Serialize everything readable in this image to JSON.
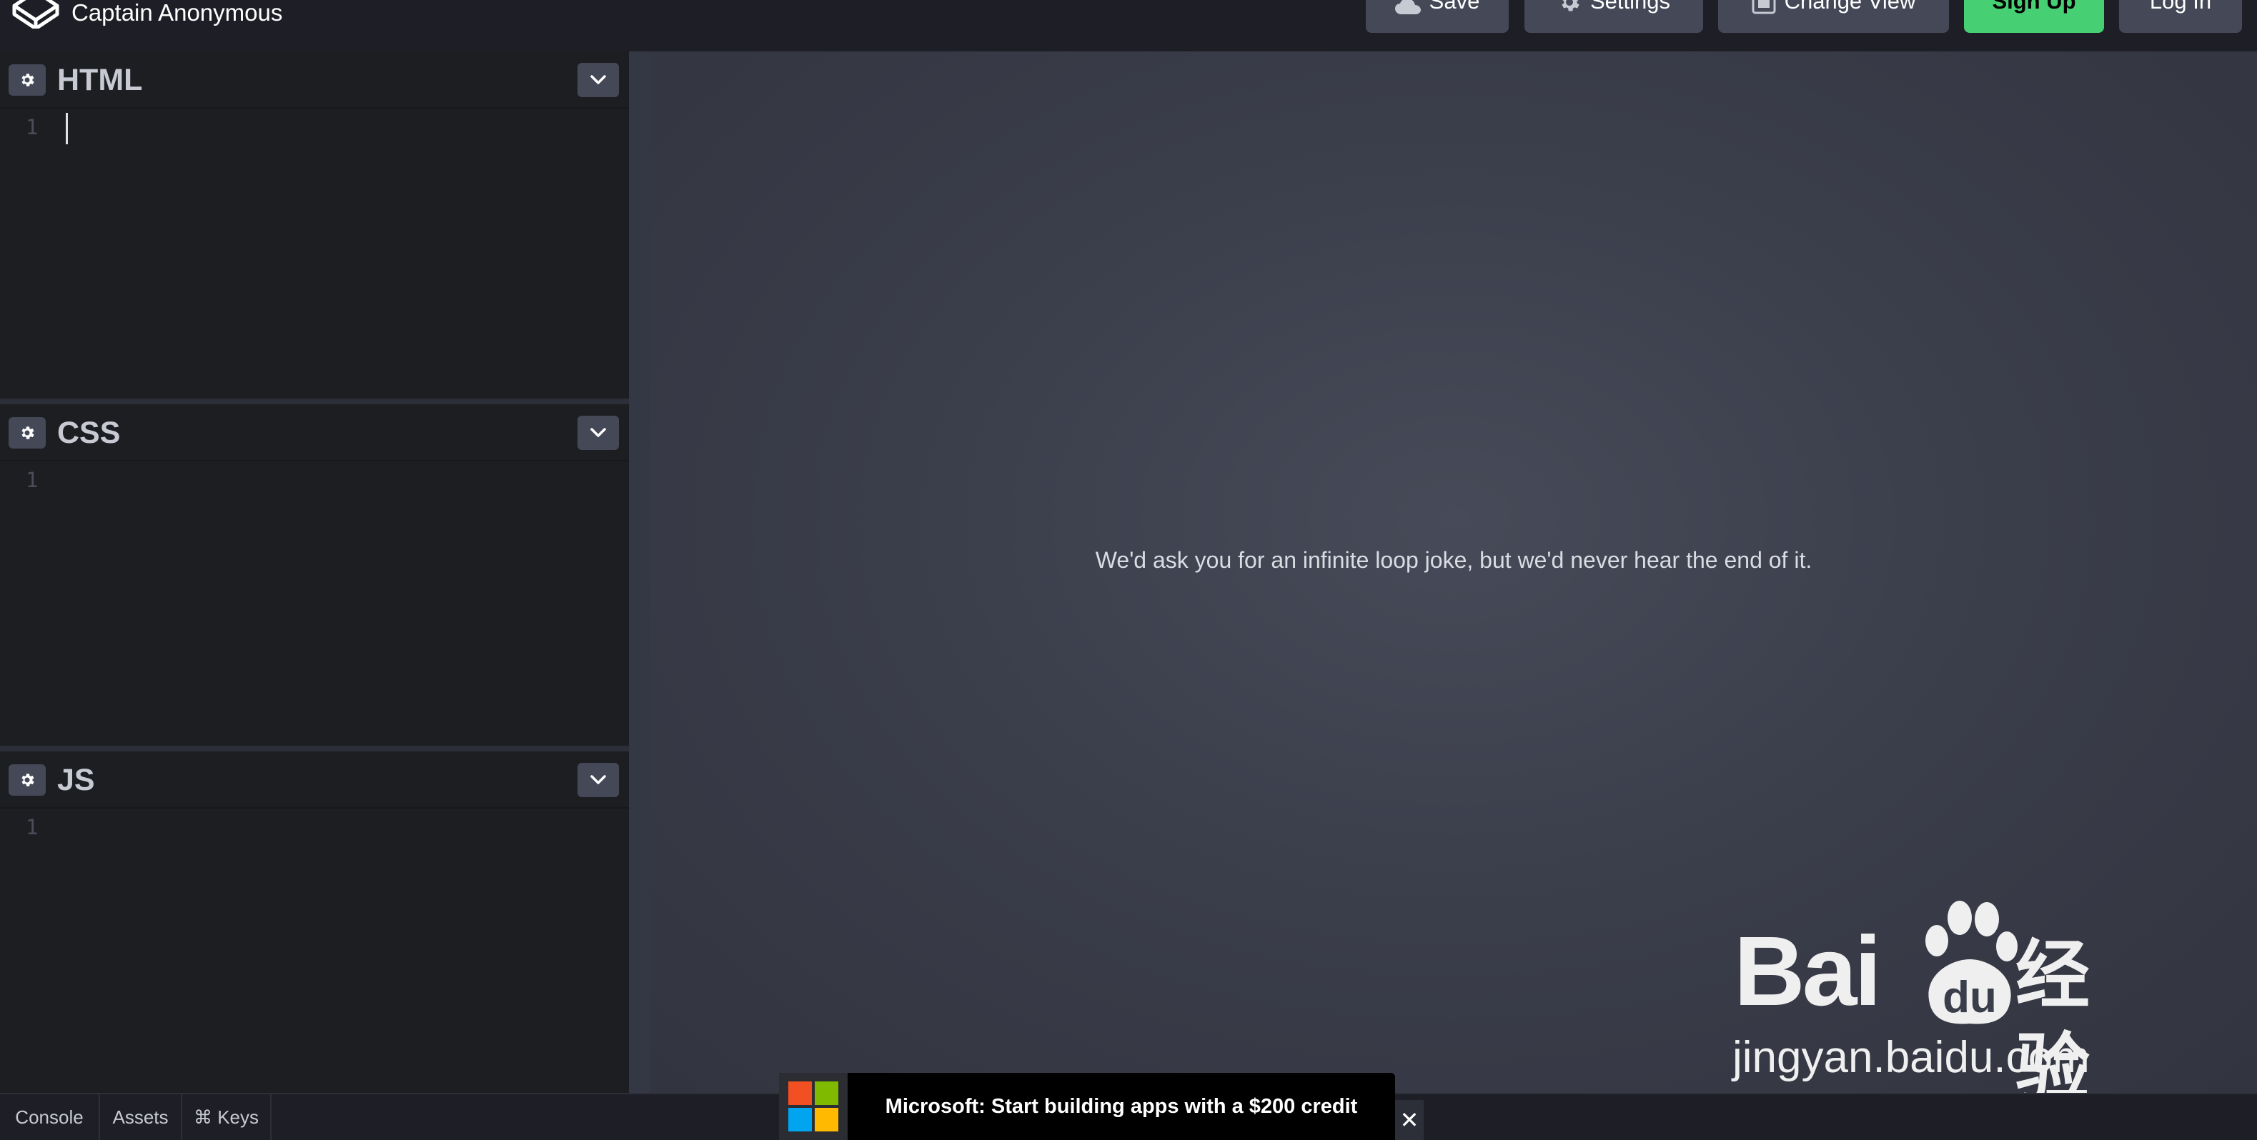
{
  "header": {
    "pen_title": "Captain Anonymous",
    "buttons": {
      "save": "Save",
      "settings": "Settings",
      "change_view": "Change View",
      "sign_up": "Sign Up",
      "log_in": "Log In"
    }
  },
  "editors": [
    {
      "title": "HTML",
      "line_number": "1",
      "has_cursor": true
    },
    {
      "title": "CSS",
      "line_number": "1",
      "has_cursor": false
    },
    {
      "title": "JS",
      "line_number": "1",
      "has_cursor": false
    }
  ],
  "preview": {
    "message": "We'd ask you for an infinite loop joke, but we'd never hear the end of it."
  },
  "footer": {
    "console": "Console",
    "assets": "Assets",
    "keys": "⌘ Keys"
  },
  "ad": {
    "text": "Microsoft: Start building apps with a $200 credit",
    "close": "✕"
  },
  "watermark": {
    "brand_bai": "Bai",
    "brand_du": "du",
    "brand_cn": "经验",
    "url": "jingyan.baidu.com"
  },
  "colors": {
    "accent_green": "#47cf73",
    "button_bg": "#444857",
    "header_bg": "#1e1f26",
    "editor_bg": "#1d1e22",
    "preview_bg": "#3b3e4b"
  },
  "icons": {
    "logo": "codepen-logo-icon",
    "save": "cloud-icon",
    "settings": "gear-icon",
    "change_view": "layout-icon",
    "editor_settings": "gear-icon",
    "editor_toggle": "chevron-down-icon",
    "ad_logo": "microsoft-logo-icon",
    "ad_close": "close-icon"
  }
}
